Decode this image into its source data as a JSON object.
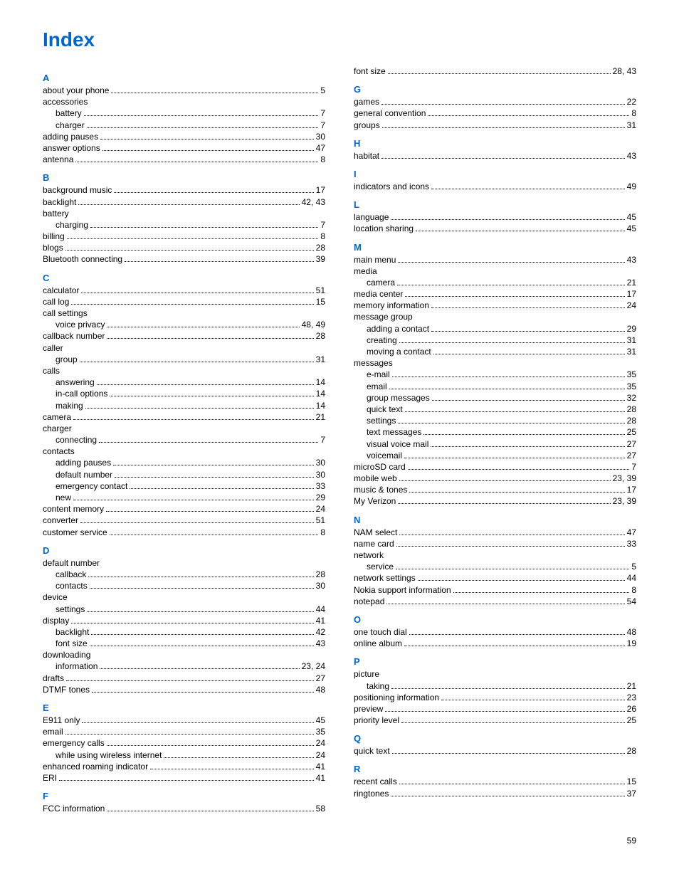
{
  "title": "Index",
  "page_number": "59",
  "columns": [
    [
      {
        "type": "letter",
        "text": "A"
      },
      {
        "type": "entry",
        "label": "about your phone",
        "pages": "5"
      },
      {
        "type": "header",
        "label": "accessories"
      },
      {
        "type": "sub",
        "label": "battery",
        "pages": "7"
      },
      {
        "type": "sub",
        "label": "charger",
        "pages": "7"
      },
      {
        "type": "entry",
        "label": "adding pauses",
        "pages": "30"
      },
      {
        "type": "entry",
        "label": "answer options",
        "pages": "47"
      },
      {
        "type": "entry",
        "label": "antenna",
        "pages": "8"
      },
      {
        "type": "letter",
        "text": "B"
      },
      {
        "type": "entry",
        "label": "background music",
        "pages": "17"
      },
      {
        "type": "entry",
        "label": "backlight",
        "pages": "42, 43"
      },
      {
        "type": "header",
        "label": "battery"
      },
      {
        "type": "sub",
        "label": "charging",
        "pages": "7"
      },
      {
        "type": "entry",
        "label": "billing",
        "pages": "8"
      },
      {
        "type": "entry",
        "label": "blogs",
        "pages": "28"
      },
      {
        "type": "entry",
        "label": "Bluetooth connecting",
        "pages": "39"
      },
      {
        "type": "letter",
        "text": "C"
      },
      {
        "type": "entry",
        "label": "calculator",
        "pages": "51"
      },
      {
        "type": "entry",
        "label": "call log",
        "pages": "15"
      },
      {
        "type": "header",
        "label": "call settings"
      },
      {
        "type": "sub",
        "label": "voice privacy",
        "pages": "48, 49"
      },
      {
        "type": "entry",
        "label": "callback number",
        "pages": "28"
      },
      {
        "type": "header",
        "label": "caller"
      },
      {
        "type": "sub",
        "label": "group",
        "pages": "31"
      },
      {
        "type": "header",
        "label": "calls"
      },
      {
        "type": "sub",
        "label": "answering",
        "pages": "14"
      },
      {
        "type": "sub",
        "label": "in-call options",
        "pages": "14"
      },
      {
        "type": "sub",
        "label": "making",
        "pages": "14"
      },
      {
        "type": "entry",
        "label": "camera",
        "pages": "21"
      },
      {
        "type": "header",
        "label": "charger"
      },
      {
        "type": "sub",
        "label": "connecting",
        "pages": "7"
      },
      {
        "type": "header",
        "label": "contacts"
      },
      {
        "type": "sub",
        "label": "adding pauses",
        "pages": "30"
      },
      {
        "type": "sub",
        "label": "default number",
        "pages": "30"
      },
      {
        "type": "sub",
        "label": "emergency contact",
        "pages": "33"
      },
      {
        "type": "sub",
        "label": "new",
        "pages": "29"
      },
      {
        "type": "entry",
        "label": "content memory",
        "pages": "24"
      },
      {
        "type": "entry",
        "label": "converter",
        "pages": "51"
      },
      {
        "type": "entry",
        "label": "customer service",
        "pages": "8"
      },
      {
        "type": "letter",
        "text": "D"
      },
      {
        "type": "header",
        "label": "default number"
      },
      {
        "type": "sub",
        "label": "callback",
        "pages": "28"
      },
      {
        "type": "sub",
        "label": "contacts",
        "pages": "30"
      },
      {
        "type": "header",
        "label": "device"
      },
      {
        "type": "sub",
        "label": "settings",
        "pages": "44"
      },
      {
        "type": "entry",
        "label": "display",
        "pages": "41"
      },
      {
        "type": "sub",
        "label": "backlight",
        "pages": "42"
      },
      {
        "type": "sub",
        "label": "font size",
        "pages": "43"
      },
      {
        "type": "header",
        "label": "downloading"
      },
      {
        "type": "sub",
        "label": "information",
        "pages": "23, 24"
      },
      {
        "type": "entry",
        "label": "drafts",
        "pages": "27"
      },
      {
        "type": "entry",
        "label": "DTMF tones",
        "pages": "48"
      },
      {
        "type": "letter",
        "text": "E"
      },
      {
        "type": "entry",
        "label": "E911 only",
        "pages": "45"
      },
      {
        "type": "entry",
        "label": "email",
        "pages": "35"
      },
      {
        "type": "entry",
        "label": "emergency calls",
        "pages": "24"
      },
      {
        "type": "sub",
        "label": "while using wireless internet",
        "pages": "24"
      },
      {
        "type": "entry",
        "label": "enhanced roaming indicator",
        "pages": "41"
      },
      {
        "type": "entry",
        "label": "ERI",
        "pages": "41"
      },
      {
        "type": "letter",
        "text": "F"
      },
      {
        "type": "entry",
        "label": "FCC information",
        "pages": "58"
      }
    ],
    [
      {
        "type": "entry",
        "label": "font size",
        "pages": "28, 43"
      },
      {
        "type": "letter",
        "text": "G"
      },
      {
        "type": "entry",
        "label": "games",
        "pages": "22"
      },
      {
        "type": "entry",
        "label": "general convention",
        "pages": "8"
      },
      {
        "type": "entry",
        "label": "groups",
        "pages": "31"
      },
      {
        "type": "letter",
        "text": "H"
      },
      {
        "type": "entry",
        "label": "habitat",
        "pages": "43"
      },
      {
        "type": "letter",
        "text": "I"
      },
      {
        "type": "entry",
        "label": "indicators and icons",
        "pages": "49"
      },
      {
        "type": "letter",
        "text": "L"
      },
      {
        "type": "entry",
        "label": "language",
        "pages": "45"
      },
      {
        "type": "entry",
        "label": "location sharing",
        "pages": "45"
      },
      {
        "type": "letter",
        "text": "M"
      },
      {
        "type": "entry",
        "label": "main menu",
        "pages": "43"
      },
      {
        "type": "header",
        "label": "media"
      },
      {
        "type": "sub",
        "label": "camera",
        "pages": "21"
      },
      {
        "type": "entry",
        "label": "media center",
        "pages": "17"
      },
      {
        "type": "entry",
        "label": "memory information",
        "pages": "24"
      },
      {
        "type": "header",
        "label": "message group"
      },
      {
        "type": "sub",
        "label": "adding a contact",
        "pages": "29"
      },
      {
        "type": "sub",
        "label": "creating",
        "pages": "31"
      },
      {
        "type": "sub",
        "label": "moving a contact",
        "pages": "31"
      },
      {
        "type": "header",
        "label": "messages"
      },
      {
        "type": "sub",
        "label": "e-mail",
        "pages": "35"
      },
      {
        "type": "sub",
        "label": "email",
        "pages": "35"
      },
      {
        "type": "sub",
        "label": "group messages",
        "pages": "32"
      },
      {
        "type": "sub",
        "label": "quick text",
        "pages": "28"
      },
      {
        "type": "sub",
        "label": "settings",
        "pages": "28"
      },
      {
        "type": "sub",
        "label": "text messages",
        "pages": "25"
      },
      {
        "type": "sub",
        "label": "visual voice mail",
        "pages": "27"
      },
      {
        "type": "sub",
        "label": "voicemail",
        "pages": "27"
      },
      {
        "type": "entry",
        "label": "microSD card",
        "pages": "7"
      },
      {
        "type": "entry",
        "label": "mobile web",
        "pages": "23, 39"
      },
      {
        "type": "entry",
        "label": "music & tones",
        "pages": "17"
      },
      {
        "type": "entry",
        "label": "My Verizon",
        "pages": "23, 39"
      },
      {
        "type": "letter",
        "text": "N"
      },
      {
        "type": "entry",
        "label": "NAM select",
        "pages": "47"
      },
      {
        "type": "entry",
        "label": "name card",
        "pages": "33"
      },
      {
        "type": "header",
        "label": "network"
      },
      {
        "type": "sub",
        "label": "service",
        "pages": "5"
      },
      {
        "type": "entry",
        "label": "network settings",
        "pages": "44"
      },
      {
        "type": "entry",
        "label": "Nokia support information",
        "pages": "8"
      },
      {
        "type": "entry",
        "label": "notepad",
        "pages": "54"
      },
      {
        "type": "letter",
        "text": "O"
      },
      {
        "type": "entry",
        "label": "one touch dial",
        "pages": "48"
      },
      {
        "type": "entry",
        "label": "online album",
        "pages": "19"
      },
      {
        "type": "letter",
        "text": "P"
      },
      {
        "type": "header",
        "label": "picture"
      },
      {
        "type": "sub",
        "label": "taking",
        "pages": "21"
      },
      {
        "type": "entry",
        "label": "positioning information",
        "pages": "23"
      },
      {
        "type": "entry",
        "label": "preview",
        "pages": "26"
      },
      {
        "type": "entry",
        "label": "priority level",
        "pages": "25"
      },
      {
        "type": "letter",
        "text": "Q"
      },
      {
        "type": "entry",
        "label": "quick text",
        "pages": "28"
      },
      {
        "type": "letter",
        "text": "R"
      },
      {
        "type": "entry",
        "label": "recent calls",
        "pages": "15"
      },
      {
        "type": "entry",
        "label": "ringtones",
        "pages": "37"
      }
    ]
  ]
}
